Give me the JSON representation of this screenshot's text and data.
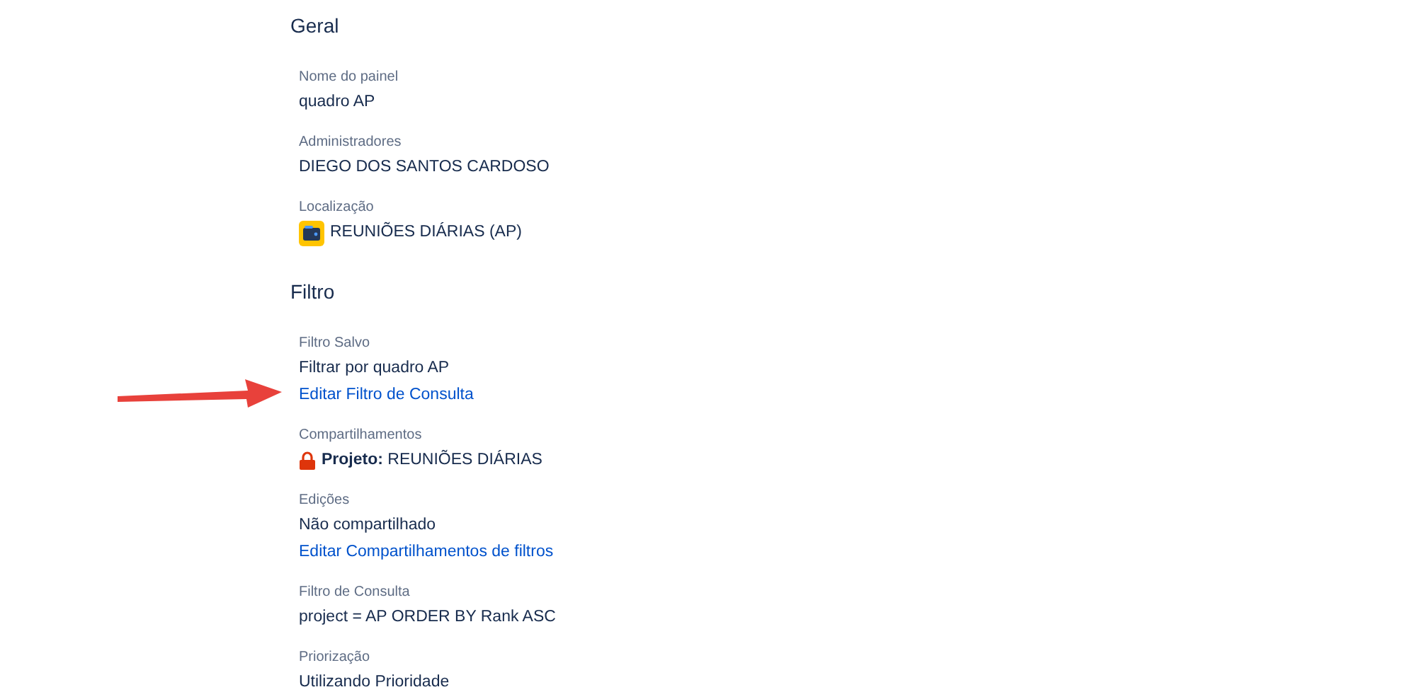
{
  "sections": [
    {
      "title": "Geral",
      "fields": [
        {
          "label": "Nome do painel",
          "lines": [
            {
              "kind": "text",
              "text": "quadro AP"
            }
          ]
        },
        {
          "label": "Administradores",
          "lines": [
            {
              "kind": "text",
              "text": "DIEGO DOS SANTOS CARDOSO"
            }
          ]
        },
        {
          "label": "Localização",
          "lines": [
            {
              "kind": "project",
              "text": "REUNIÕES DIÁRIAS (AP)"
            }
          ]
        }
      ]
    },
    {
      "title": "Filtro",
      "fields": [
        {
          "label": "Filtro Salvo",
          "lines": [
            {
              "kind": "text",
              "text": "Filtrar por quadro AP"
            },
            {
              "kind": "link",
              "text": "Editar Filtro de Consulta",
              "arrow": true
            }
          ]
        },
        {
          "label": "Compartilhamentos",
          "lines": [
            {
              "kind": "locked",
              "text": "**Projeto:** REUNIÕES DIÁRIAS"
            }
          ]
        },
        {
          "label": "Edições",
          "lines": [
            {
              "kind": "text",
              "text": "Não compartilhado"
            },
            {
              "kind": "link",
              "text": "Editar Compartilhamentos de filtros"
            }
          ]
        },
        {
          "label": "Filtro de Consulta",
          "lines": [
            {
              "kind": "text",
              "text": "project = AP ORDER BY Rank ASC"
            }
          ]
        },
        {
          "label": "Priorização",
          "lines": [
            {
              "kind": "text",
              "text": "Utilizando Prioridade"
            }
          ]
        }
      ]
    }
  ]
}
